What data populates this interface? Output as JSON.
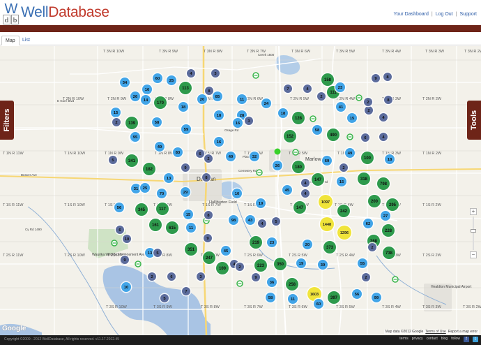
{
  "brand": {
    "logo_w": "W",
    "logo_d": "d",
    "logo_b": "b",
    "name_part1": "Well",
    "name_part2": "Database"
  },
  "toplinks": {
    "dashboard": "Your Dashboard",
    "logout": "Log Out",
    "support": "Support",
    "separator": "|"
  },
  "tabs": {
    "map": "Map",
    "list": "List"
  },
  "side": {
    "filters": "Filters",
    "tools": "Tools"
  },
  "zoom": {
    "plus": "+",
    "minus": "−"
  },
  "map_attrib": {
    "google": "Google",
    "data": "Map data ©2012 Google",
    "terms": "Terms of Use",
    "report": "Report a map error"
  },
  "footer": {
    "copyright": "Copyright ©2009 - 2012 WellDatabase, All rights reserved. v11.17.2012.45",
    "links": [
      "terms",
      "privacy",
      "contact",
      "blog",
      "follow"
    ],
    "facebook": "f",
    "twitter": "t"
  },
  "colors": {
    "blue": "#42a5e8",
    "navy": "#5c6c9c",
    "green": "#2e9a4c",
    "yellow": "#f0e43a",
    "brand": "#6e2418"
  },
  "map_labels": {
    "grid": [
      "T 3N R 10W",
      "T 3N R 9W",
      "T 3N R 8W",
      "T 3N R 7W",
      "T 3N R 6W",
      "T 3N R 5W",
      "T 3N R 4W",
      "T 3N R 3W",
      "T 3N R 2W",
      "T 2N R 10W",
      "T 2N R 9W",
      "T 2N R 8W",
      "T 2N R 7W",
      "T 2N R 6W",
      "T 2N R 5W",
      "T 2N R 4W",
      "T 2N R 3W",
      "T 2N R 2W",
      "T 1N R 11W",
      "T 1N R 10W",
      "T 1N R 9W",
      "T 1N R 8W",
      "T 1N R 7W",
      "T 1N R 6W",
      "T 1N R 5W",
      "T 1N R 4W",
      "T 1N R 3W",
      "T 1N R 2W",
      "T 1S R 11W",
      "T 1S R 10W",
      "T 1S R 9W",
      "T 1S R 8W",
      "T 1S R 7W",
      "T 1S R 6W",
      "T 1S R 5W",
      "T 1S R 4W",
      "T 1S R 3W",
      "T 1S R 2W",
      "T 2S R 11W",
      "T 2S R 10W",
      "T 2S R 9W",
      "T 2S R 8W",
      "T 2S R 7W",
      "T 2S R 6W",
      "T 2S R 5W",
      "T 2S R 4W",
      "T 2S R 3W",
      "T 2S R 2W",
      "T 3S R 10W",
      "T 3S R 9W",
      "T 3S R 8W",
      "T 3S R 7W",
      "T 3S R 6W",
      "T 3S R 5W",
      "T 3S R 4W",
      "T 3S R 3W",
      "T 3S R 2W"
    ],
    "places": [
      "Duncan",
      "Halliburton Field",
      "Marlow",
      "Waurika Wildlife Management Area - North",
      "Healdton Municipal Airport",
      "Cemetery Rd",
      "Bois D Arc Rd",
      "Osage Rd",
      "Plato Rd",
      "E Gore Blvd",
      "Beaver Ave",
      "Creek 1500",
      "Cy Rd 1490"
    ]
  },
  "clusters": [
    {
      "v": "34",
      "c": "blue"
    },
    {
      "v": "60",
      "c": "blue"
    },
    {
      "v": "25",
      "c": "blue"
    },
    {
      "v": "4",
      "c": "navy"
    },
    {
      "v": "3",
      "c": "navy"
    },
    {
      "v": "158",
      "c": "green"
    },
    {
      "v": "9",
      "c": "navy"
    },
    {
      "v": "8",
      "c": "navy"
    },
    {
      "v": "16",
      "c": "blue"
    },
    {
      "v": "113",
      "c": "green"
    },
    {
      "v": "8",
      "c": "navy"
    },
    {
      "v": "7",
      "c": "navy"
    },
    {
      "v": "4",
      "c": "navy"
    },
    {
      "v": "111",
      "c": "green"
    },
    {
      "v": "23",
      "c": "blue"
    },
    {
      "v": "26",
      "c": "blue"
    },
    {
      "v": "14",
      "c": "blue"
    },
    {
      "v": "170",
      "c": "green"
    },
    {
      "v": "20",
      "c": "blue"
    },
    {
      "v": "85",
      "c": "blue"
    },
    {
      "v": "11",
      "c": "blue"
    },
    {
      "v": "24",
      "c": "blue"
    },
    {
      "v": "2",
      "c": "navy"
    },
    {
      "v": "41",
      "c": "blue"
    },
    {
      "v": "2",
      "c": "navy"
    },
    {
      "v": "8",
      "c": "navy"
    },
    {
      "v": "15",
      "c": "blue"
    },
    {
      "v": "18",
      "c": "blue"
    },
    {
      "v": "18",
      "c": "blue"
    },
    {
      "v": "28",
      "c": "blue"
    },
    {
      "v": "18",
      "c": "blue"
    },
    {
      "v": "128",
      "c": "green"
    },
    {
      "v": "15",
      "c": "blue"
    },
    {
      "v": "2",
      "c": "navy"
    },
    {
      "v": "4",
      "c": "navy"
    },
    {
      "v": "2",
      "c": "navy"
    },
    {
      "v": "139",
      "c": "green"
    },
    {
      "v": "58",
      "c": "blue"
    },
    {
      "v": "16",
      "c": "blue"
    },
    {
      "v": "3",
      "c": "navy"
    },
    {
      "v": "58",
      "c": "blue"
    },
    {
      "v": "42",
      "c": "blue"
    },
    {
      "v": "95",
      "c": "blue"
    },
    {
      "v": "59",
      "c": "blue"
    },
    {
      "v": "16",
      "c": "blue"
    },
    {
      "v": "152",
      "c": "green"
    },
    {
      "v": "490",
      "c": "green"
    },
    {
      "v": "6",
      "c": "navy"
    },
    {
      "v": "4",
      "c": "navy"
    },
    {
      "v": "49",
      "c": "blue"
    },
    {
      "v": "4",
      "c": "navy"
    },
    {
      "v": "5",
      "c": "navy"
    },
    {
      "v": "341",
      "c": "green"
    },
    {
      "v": "182",
      "c": "green"
    },
    {
      "v": "83",
      "c": "blue"
    },
    {
      "v": "6",
      "c": "navy"
    },
    {
      "v": "2",
      "c": "navy"
    },
    {
      "v": "49",
      "c": "blue"
    },
    {
      "v": "32",
      "c": "blue"
    },
    {
      "v": "26",
      "c": "blue"
    },
    {
      "v": "180",
      "c": "green"
    },
    {
      "v": "69",
      "c": "blue"
    },
    {
      "v": "49",
      "c": "blue"
    },
    {
      "v": "100",
      "c": "green"
    },
    {
      "v": "18",
      "c": "blue"
    },
    {
      "v": "9",
      "c": "navy"
    },
    {
      "v": "2",
      "c": "navy"
    },
    {
      "v": "13",
      "c": "blue"
    },
    {
      "v": "8",
      "c": "navy"
    },
    {
      "v": "4",
      "c": "navy"
    },
    {
      "v": "147",
      "c": "green"
    },
    {
      "v": "15",
      "c": "blue"
    },
    {
      "v": "318",
      "c": "green"
    },
    {
      "v": "798",
      "c": "green"
    },
    {
      "v": "31",
      "c": "blue"
    },
    {
      "v": "25",
      "c": "blue"
    },
    {
      "v": "70",
      "c": "blue"
    },
    {
      "v": "29",
      "c": "blue"
    },
    {
      "v": "10",
      "c": "blue"
    },
    {
      "v": "45",
      "c": "blue"
    },
    {
      "v": "4",
      "c": "navy"
    },
    {
      "v": "56",
      "c": "blue"
    },
    {
      "v": "345",
      "c": "green"
    },
    {
      "v": "117",
      "c": "green"
    },
    {
      "v": "19",
      "c": "blue"
    },
    {
      "v": "147",
      "c": "green"
    },
    {
      "v": "1097",
      "c": "yellow"
    },
    {
      "v": "242",
      "c": "green"
    },
    {
      "v": "200",
      "c": "green"
    },
    {
      "v": "295",
      "c": "green"
    },
    {
      "v": "15",
      "c": "blue"
    },
    {
      "v": "8",
      "c": "navy"
    },
    {
      "v": "98",
      "c": "blue"
    },
    {
      "v": "43",
      "c": "blue"
    },
    {
      "v": "4",
      "c": "navy"
    },
    {
      "v": "5",
      "c": "navy"
    },
    {
      "v": "27",
      "c": "blue"
    },
    {
      "v": "6",
      "c": "navy"
    },
    {
      "v": "10",
      "c": "navy"
    },
    {
      "v": "161",
      "c": "green"
    },
    {
      "v": "615",
      "c": "green"
    },
    {
      "v": "11",
      "c": "blue"
    },
    {
      "v": "1448",
      "c": "yellow"
    },
    {
      "v": "1296",
      "c": "yellow"
    },
    {
      "v": "62",
      "c": "blue"
    },
    {
      "v": "228",
      "c": "green"
    },
    {
      "v": "5",
      "c": "navy"
    },
    {
      "v": "9",
      "c": "navy"
    },
    {
      "v": "219",
      "c": "green"
    },
    {
      "v": "23",
      "c": "blue"
    },
    {
      "v": "20",
      "c": "blue"
    },
    {
      "v": "368",
      "c": "green"
    },
    {
      "v": "13",
      "c": "blue"
    },
    {
      "v": "5",
      "c": "navy"
    },
    {
      "v": "351",
      "c": "green"
    },
    {
      "v": "45",
      "c": "blue"
    },
    {
      "v": "373",
      "c": "green"
    },
    {
      "v": "2",
      "c": "navy"
    },
    {
      "v": "738",
      "c": "green"
    },
    {
      "v": "9",
      "c": "navy"
    },
    {
      "v": "247",
      "c": "green"
    },
    {
      "v": "4",
      "c": "navy"
    },
    {
      "v": "100",
      "c": "green"
    },
    {
      "v": "2",
      "c": "navy"
    },
    {
      "v": "223",
      "c": "green"
    },
    {
      "v": "350",
      "c": "green"
    },
    {
      "v": "19",
      "c": "blue"
    },
    {
      "v": "39",
      "c": "blue"
    },
    {
      "v": "55",
      "c": "blue"
    },
    {
      "v": "2",
      "c": "navy"
    },
    {
      "v": "6",
      "c": "navy"
    },
    {
      "v": "3",
      "c": "navy"
    },
    {
      "v": "9",
      "c": "navy"
    },
    {
      "v": "2",
      "c": "navy"
    },
    {
      "v": "10",
      "c": "blue"
    },
    {
      "v": "36",
      "c": "blue"
    },
    {
      "v": "258",
      "c": "green"
    },
    {
      "v": "7",
      "c": "navy"
    },
    {
      "v": "5",
      "c": "navy"
    },
    {
      "v": "58",
      "c": "blue"
    },
    {
      "v": "11",
      "c": "blue"
    },
    {
      "v": "1603",
      "c": "yellow"
    },
    {
      "v": "397",
      "c": "green"
    },
    {
      "v": "56",
      "c": "blue"
    },
    {
      "v": "99",
      "c": "blue"
    },
    {
      "v": "60",
      "c": "blue"
    }
  ]
}
